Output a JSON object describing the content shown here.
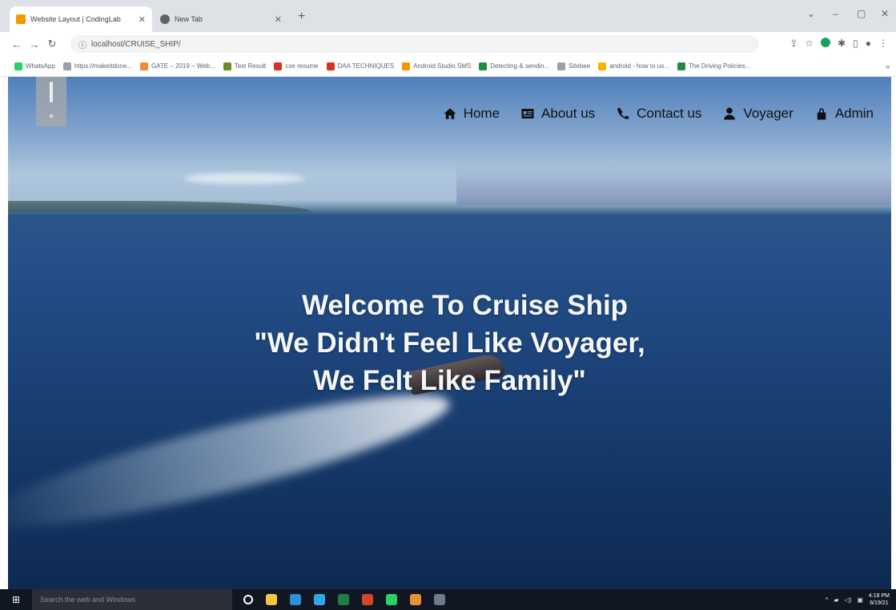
{
  "browser": {
    "tabs": [
      {
        "title": "Website Layout | CodingLab",
        "favicon_color": "#f29900",
        "active": true
      },
      {
        "title": "New Tab",
        "favicon_color": "#5f6368",
        "active": false
      }
    ],
    "new_tab_glyph": "+",
    "window_controls": {
      "minimize": "–",
      "maximize": "▢",
      "close": "✕",
      "dropdown": "⌄"
    },
    "address": "localhost/CRUISE_SHIP/",
    "bookmarks": [
      {
        "label": "WhatsApp",
        "color": "#25d366"
      },
      {
        "label": "https://makeitdone...",
        "color": "#9aa0a6"
      },
      {
        "label": "GATE – 2019 – Web...",
        "color": "#f28b30"
      },
      {
        "label": "Test Result",
        "color": "#6a8e23"
      },
      {
        "label": "cse resume",
        "color": "#d93025"
      },
      {
        "label": "DAA TECHNIQUES",
        "color": "#d93025"
      },
      {
        "label": "Android Studio SMS",
        "color": "#f29900"
      },
      {
        "label": "Detecting & sendin...",
        "color": "#1e8e3e"
      },
      {
        "label": "Sitebee",
        "color": "#9aa0a6"
      },
      {
        "label": "android - how to us...",
        "color": "#f4b400"
      },
      {
        "label": "The Driving Policies...",
        "color": "#1e8e3e"
      }
    ],
    "bookmarks_more": "»"
  },
  "site": {
    "nav": [
      {
        "label": "Home",
        "icon": "home-icon"
      },
      {
        "label": "About us",
        "icon": "id-card-icon"
      },
      {
        "label": "Contact us",
        "icon": "phone-icon"
      },
      {
        "label": "Voyager",
        "icon": "user-icon"
      },
      {
        "label": "Admin",
        "icon": "lock-icon"
      }
    ],
    "hero": {
      "line1": "Welcome To Cruise Ship",
      "line2": "\"We Didn't Feel Like Voyager,",
      "line3": "We Felt Like Family\""
    },
    "scroll_widget_glyph": "+"
  },
  "taskbar": {
    "search_placeholder": "Search the web and Windows",
    "apps": [
      {
        "name": "task-view",
        "color": "#ffffff"
      },
      {
        "name": "file-explorer",
        "color": "#f4c542"
      },
      {
        "name": "edge",
        "color": "#2d8fe0"
      },
      {
        "name": "chrome",
        "color": "#2ea8e8"
      },
      {
        "name": "excel",
        "color": "#1e7e45"
      },
      {
        "name": "powerpoint",
        "color": "#d24726"
      },
      {
        "name": "whatsapp",
        "color": "#25d366"
      },
      {
        "name": "notes",
        "color": "#e69138"
      },
      {
        "name": "chrome-active",
        "color": "#6f7a8a"
      }
    ],
    "clock_time": "4:18 PM",
    "clock_date": "6/19/21"
  }
}
